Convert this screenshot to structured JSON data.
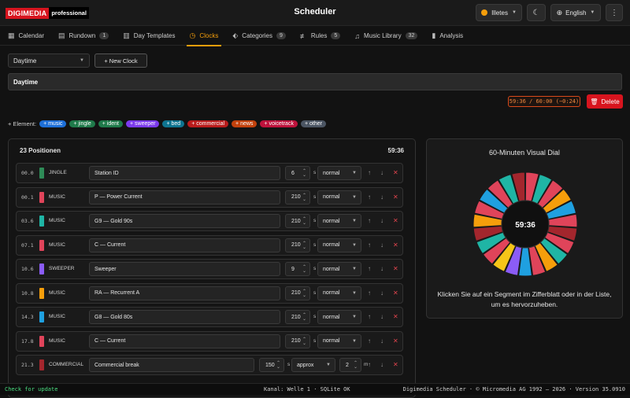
{
  "app": {
    "logo_brand": "DIGIMEDIA",
    "logo_edition": "professional",
    "title": "Scheduler",
    "station": "Illetes",
    "language": "English",
    "station_dot_color": "#f59e0b"
  },
  "tabs": [
    {
      "label": "Calendar",
      "icon": "calendar-icon",
      "glyph": "▦"
    },
    {
      "label": "Rundown",
      "icon": "rundown-icon",
      "glyph": "▤",
      "badge": "1"
    },
    {
      "label": "Day Templates",
      "icon": "day-templates-icon",
      "glyph": "▥"
    },
    {
      "label": "Clocks",
      "icon": "clock-icon",
      "glyph": "◷",
      "active": true
    },
    {
      "label": "Categories",
      "icon": "tag-icon",
      "glyph": "⬖",
      "badge": "9"
    },
    {
      "label": "Rules",
      "icon": "sliders-icon",
      "glyph": "≢",
      "badge": "5"
    },
    {
      "label": "Music Library",
      "icon": "music-note-icon",
      "glyph": "♫",
      "badge": "32"
    },
    {
      "label": "Analysis",
      "icon": "bar-chart-icon",
      "glyph": "▮"
    }
  ],
  "clock_select": {
    "value": "Daytime"
  },
  "new_clock_label": "+ New Clock",
  "clock_name": "Daytime",
  "duration_readout": "59:36 / 60:00 (−0:24)",
  "delete_label": "Delete",
  "element_label": "+ Element:",
  "elements": [
    {
      "label": "+ music",
      "color": "#1d6fd8"
    },
    {
      "label": "+ jingle",
      "color": "#1f7a4a"
    },
    {
      "label": "+ ident",
      "color": "#1f7a4a"
    },
    {
      "label": "+ sweeper",
      "color": "#7c3aed"
    },
    {
      "label": "+ bed",
      "color": "#0e7490"
    },
    {
      "label": "+ commercial",
      "color": "#b91c1c"
    },
    {
      "label": "+ news",
      "color": "#c2410c"
    },
    {
      "label": "+ voicetrack",
      "color": "#be123c"
    },
    {
      "label": "+ other",
      "color": "#4b5563"
    }
  ],
  "list": {
    "positions_label": "23 Positionen",
    "total": "59:36",
    "rows": [
      {
        "time": "00.0",
        "color": "#2e8b57",
        "type": "JINGLE",
        "title": "Station ID",
        "num": "6",
        "unit": "s",
        "mode": "normal"
      },
      {
        "time": "00.1",
        "color": "#e0445a",
        "type": "MUSIC",
        "title": "P — Power Current",
        "num": "210",
        "unit": "s",
        "mode": "normal"
      },
      {
        "time": "03.6",
        "color": "#1fb5a5",
        "type": "MUSIC",
        "title": "G9 — Gold 90s",
        "num": "210",
        "unit": "s",
        "mode": "normal"
      },
      {
        "time": "07.1",
        "color": "#e0445a",
        "type": "MUSIC",
        "title": "C — Current",
        "num": "210",
        "unit": "s",
        "mode": "normal"
      },
      {
        "time": "10.6",
        "color": "#8b5cf6",
        "type": "SWEEPER",
        "title": "Sweeper",
        "num": "9",
        "unit": "s",
        "mode": "normal"
      },
      {
        "time": "10.8",
        "color": "#f59e0b",
        "type": "MUSIC",
        "title": "RA — Recurrent A",
        "num": "210",
        "unit": "s",
        "mode": "normal"
      },
      {
        "time": "14.3",
        "color": "#1fa0e0",
        "type": "MUSIC",
        "title": "G8 — Gold 80s",
        "num": "210",
        "unit": "s",
        "mode": "normal"
      },
      {
        "time": "17.8",
        "color": "#e0445a",
        "type": "MUSIC",
        "title": "C — Current",
        "num": "210",
        "unit": "s",
        "mode": "normal"
      },
      {
        "time": "21.3",
        "color": "#a3262d",
        "type": "COMMERCIAL",
        "title": "Commercial break",
        "num": "150",
        "unit": "s",
        "mode": "approx",
        "num2": "2",
        "unit2": "m"
      }
    ]
  },
  "dial": {
    "title": "60-Minuten Visual Dial",
    "center_time": "59:36",
    "hint": "Klicken Sie auf ein Segment im Zifferblatt oder in der Liste, um es hervorzuheben.",
    "segment_colors": [
      "#e0445a",
      "#1fb5a5",
      "#e0445a",
      "#f59e0b",
      "#1fa0e0",
      "#e0445a",
      "#a3262d",
      "#e0445a",
      "#1fb5a5",
      "#f59e0b",
      "#e0445a",
      "#1fa0e0",
      "#8b5cf6",
      "#f5c518",
      "#e0445a",
      "#1fb5a5",
      "#a3262d",
      "#f59e0b",
      "#e0445a",
      "#1fa0e0",
      "#e0445a",
      "#1fb5a5",
      "#a3262d"
    ]
  },
  "status": {
    "left": "Check for update",
    "middle": "Kanal: Welle 1 · SQLite OK",
    "right": "Digimedia Scheduler · © Micromedia AG 1992 – 2026 · Version 35.0910"
  }
}
